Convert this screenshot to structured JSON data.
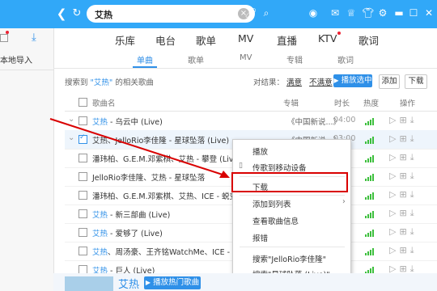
{
  "colors": {
    "accent": "#31a8f8",
    "highlight": "#2f90e8",
    "annotation": "#d90000",
    "heat": "#3cbf3c"
  },
  "topbar": {
    "back_icon": "chevron-left-icon",
    "refresh_icon": "refresh-icon",
    "search_value": "艾热",
    "mic_icon": "microphone-icon",
    "magnifier_icon": "search-icon"
  },
  "sidebar": {
    "import_label": "本地导入",
    "download_icon": "download-icon"
  },
  "main_tabs": [
    "乐库",
    "电台",
    "歌单",
    "MV",
    "直播",
    "KTV",
    "歌词"
  ],
  "sub_tabs": [
    "单曲",
    "歌单",
    "MV",
    "专辑",
    "歌词"
  ],
  "search_info": {
    "prefix": "搜索到",
    "keyword": "\"艾热\"",
    "suffix": "的相关歌曲",
    "result_label": "对结果：",
    "satisfied": "满意",
    "unsatisfied": "不满意",
    "play_selected": "播放选中",
    "add": "添加",
    "download": "下载"
  },
  "table_headers": {
    "name": "歌曲名",
    "album": "专辑",
    "duration": "时长",
    "heat": "热度",
    "ops": "操作"
  },
  "rows": [
    {
      "hl": "艾热",
      "rest": " - 乌云中 (Live)",
      "album": "《中国新说...》",
      "duration": "04:00",
      "checked": false
    },
    {
      "hl": "",
      "rest": "艾热、JelloRio李佳隆 - 星球坠落 (Live)",
      "album": "《中国新说...》",
      "duration": "03:00",
      "checked": true
    },
    {
      "hl": "",
      "rest": "潘玮柏、G.E.M.邓紫棋、艾热 - 攀登 (Live)",
      "album": "",
      "duration": "",
      "checked": false
    },
    {
      "hl": "",
      "rest": "JelloRio李佳隆、艾热 - 星球坠落",
      "album": "",
      "duration": "",
      "checked": false
    },
    {
      "hl": "",
      "rest": "潘玮柏、G.E.M.邓紫棋、艾热、ICE - 蜕变 (Live)",
      "album": "",
      "duration": "",
      "checked": false
    },
    {
      "hl": "艾热",
      "rest": " - 新三部曲 (Live)",
      "album": "",
      "duration": "",
      "checked": false
    },
    {
      "hl": "艾热",
      "rest": " - 爱够了 (Live)",
      "album": "",
      "duration": "",
      "checked": false
    },
    {
      "hl": "艾热",
      "rest": "、周汤豪、王齐铭WatchMe、ICE - 顶",
      "album": "",
      "duration": "",
      "checked": false
    },
    {
      "hl": "艾热",
      "rest": " - 巨人 (Live)",
      "album": "",
      "duration": "",
      "checked": false
    }
  ],
  "context_menu": {
    "items": [
      "播放",
      "传歌到移动设备",
      "下载",
      "添加到列表",
      "查看歌曲信息",
      "报错",
      "搜索\"JelloRio李佳隆\"",
      "搜索\"星球坠落 (Live)\""
    ]
  },
  "bottom": {
    "artist": "艾热",
    "play_hot": "播放热门歌曲"
  }
}
